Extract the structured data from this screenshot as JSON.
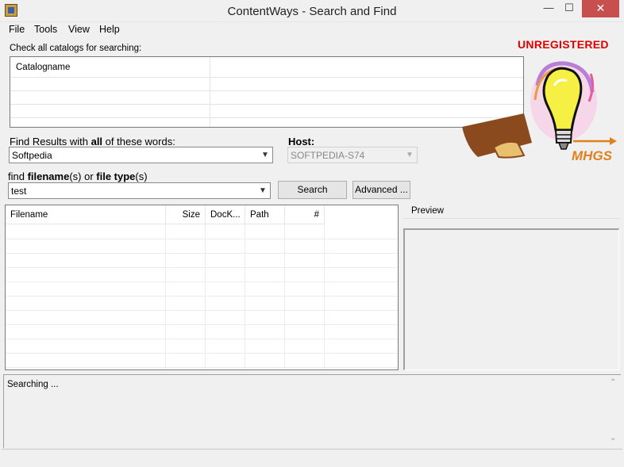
{
  "window": {
    "title": "ContentWays - Search and Find",
    "min_glyph": "—",
    "max_glyph": "☐",
    "close_glyph": "✕"
  },
  "menu": {
    "items": [
      "File",
      "Tools",
      "View",
      "Help"
    ]
  },
  "banner": {
    "status": "UNREGISTERED",
    "logo_text": "MHGS"
  },
  "catalogs": {
    "label": "Check all catalogs for searching:",
    "column_header": "Catalogname"
  },
  "find_words": {
    "label_prefix": "Find Results with ",
    "label_bold": "all",
    "label_suffix": " of these words:",
    "value": "Softpedia"
  },
  "host": {
    "label": "Host:",
    "value": "SOFTPEDIA-S74"
  },
  "find_filename": {
    "label_1": "find ",
    "label_2": "filename",
    "label_3": "(s) or ",
    "label_4": "file type",
    "label_5": "(s)",
    "value": "test"
  },
  "buttons": {
    "search": "Search",
    "advanced": "Advanced ..."
  },
  "results": {
    "columns": [
      "Filename",
      "Size",
      "DocK...",
      "Path",
      "#"
    ]
  },
  "preview": {
    "label": "Preview"
  },
  "status": {
    "text": "Searching ..."
  },
  "colors": {
    "accent_red": "#e00000",
    "close_button": "#c7504f"
  },
  "icons": {
    "app": "app-icon",
    "dropdown": "chevron-down-icon"
  }
}
